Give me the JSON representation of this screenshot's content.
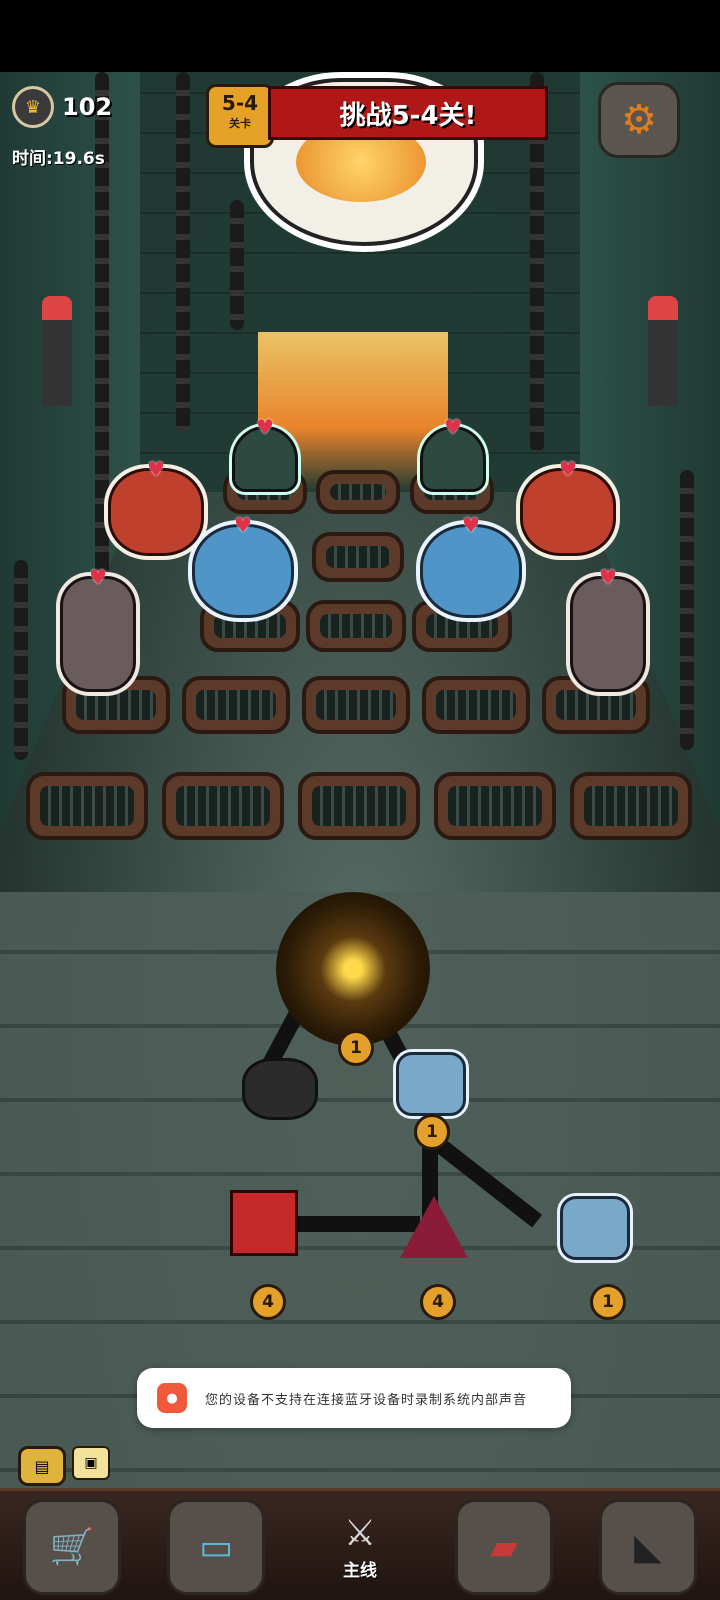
{
  "hud": {
    "crown_count": "102",
    "timer": "时间:19.6s",
    "level": {
      "number": "5-4",
      "sub": "关卡"
    },
    "banner": "挑战5-4关!"
  },
  "skill_tree": {
    "core_level": "1",
    "fist_upper_level": "1",
    "box_level": "4",
    "spike_level": "4",
    "fist_right_level": "1"
  },
  "toast": {
    "text": "您的设备不支持在连接蓝牙设备时录制系统内部声音"
  },
  "bottom_nav": {
    "items": [
      {
        "name": "shop",
        "label": ""
      },
      {
        "name": "tv",
        "label": ""
      },
      {
        "name": "main",
        "label": "主线"
      },
      {
        "name": "backpack",
        "label": ""
      },
      {
        "name": "crow",
        "label": ""
      }
    ]
  }
}
